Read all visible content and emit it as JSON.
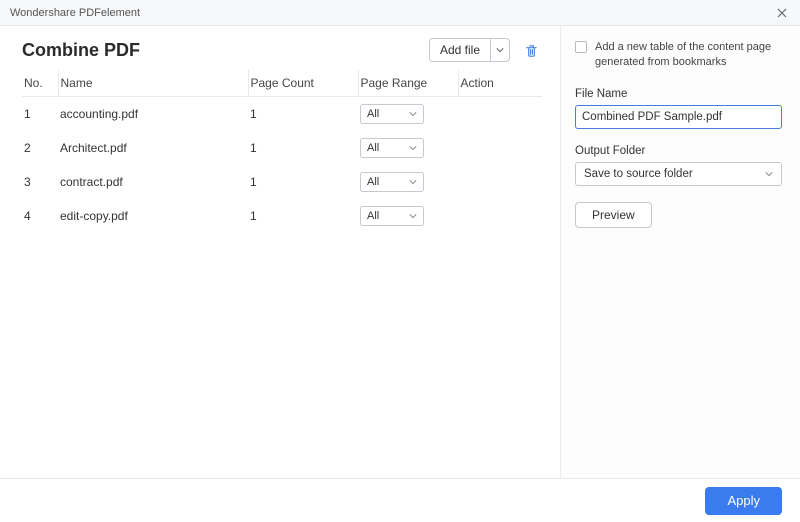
{
  "window": {
    "title": "Wondershare PDFelement"
  },
  "page": {
    "title": "Combine PDF"
  },
  "toolbar": {
    "add_file_label": "Add file"
  },
  "table": {
    "headers": {
      "no": "No.",
      "name": "Name",
      "count": "Page Count",
      "range": "Page Range",
      "action": "Action"
    },
    "rows": [
      {
        "no": "1",
        "name": "accounting.pdf",
        "count": "1",
        "range": "All"
      },
      {
        "no": "2",
        "name": "Architect.pdf",
        "count": "1",
        "range": "All"
      },
      {
        "no": "3",
        "name": "contract.pdf",
        "count": "1",
        "range": "All"
      },
      {
        "no": "4",
        "name": "edit-copy.pdf",
        "count": "1",
        "range": "All"
      }
    ]
  },
  "side": {
    "bookmark_option": "Add a new table of the content page generated from bookmarks",
    "file_name_label": "File Name",
    "file_name_value": "Combined PDF Sample.pdf",
    "output_folder_label": "Output Folder",
    "output_folder_value": "Save to source folder",
    "preview_label": "Preview"
  },
  "footer": {
    "apply_label": "Apply"
  }
}
